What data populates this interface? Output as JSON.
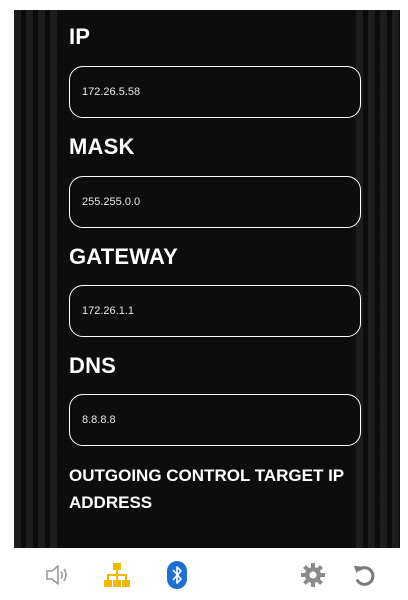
{
  "network": {
    "ip": {
      "label": "IP",
      "value": "172.26.5.58"
    },
    "mask": {
      "label": "MASK",
      "value": "255.255.0.0"
    },
    "gateway": {
      "label": "GATEWAY",
      "value": "172.26.1.1"
    },
    "dns": {
      "label": "DNS",
      "value": "8.8.8.8"
    },
    "outgoing_title": "OUTGOING CONTROL TARGET IP ADDRESS"
  },
  "toolbar": {
    "icons": [
      "speaker-icon",
      "network-icon",
      "bluetooth-icon",
      "gear-icon",
      "undo-icon"
    ],
    "colors": {
      "speaker": "#9a9a9a",
      "network": "#f2b705",
      "bluetooth": "#1f6fd1",
      "gear": "#8a8a8a",
      "undo": "#7a7a7a"
    }
  },
  "theme": {
    "background": "#0d0d0d",
    "text": "#ffffff"
  }
}
